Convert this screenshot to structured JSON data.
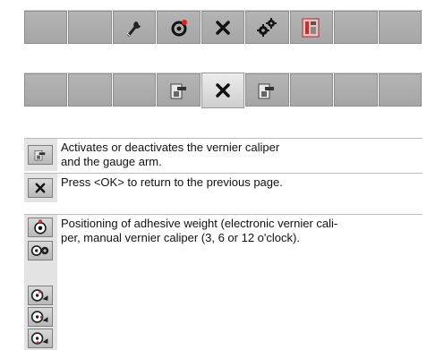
{
  "toolbar_top": {
    "buttons": [
      {
        "icon": "blank"
      },
      {
        "icon": "blank"
      },
      {
        "icon": "wrench-icon"
      },
      {
        "icon": "rotate-target-icon"
      },
      {
        "icon": "close-icon"
      },
      {
        "icon": "gears-icon"
      },
      {
        "icon": "caliper-settings-icon"
      },
      {
        "icon": "blank"
      },
      {
        "icon": "blank"
      }
    ]
  },
  "toolbar_bottom": {
    "buttons": [
      {
        "icon": "blank"
      },
      {
        "icon": "blank"
      },
      {
        "icon": "blank"
      },
      {
        "icon": "caliper-icon"
      },
      {
        "icon": "close-icon",
        "active": true
      },
      {
        "icon": "caliper-icon"
      },
      {
        "icon": "blank"
      },
      {
        "icon": "blank"
      },
      {
        "icon": "blank"
      }
    ]
  },
  "legend": [
    {
      "line1": "Activates or deactivates the vernier caliper",
      "line2": "and the gauge arm."
    },
    {
      "line1": "Press <OK> to return to the previous page."
    },
    {
      "line1": "Positioning of adhesive weight (electronic vernier cali-",
      "line2": "per, manual vernier caliper (3, 6 or 12 o'clock)."
    }
  ]
}
